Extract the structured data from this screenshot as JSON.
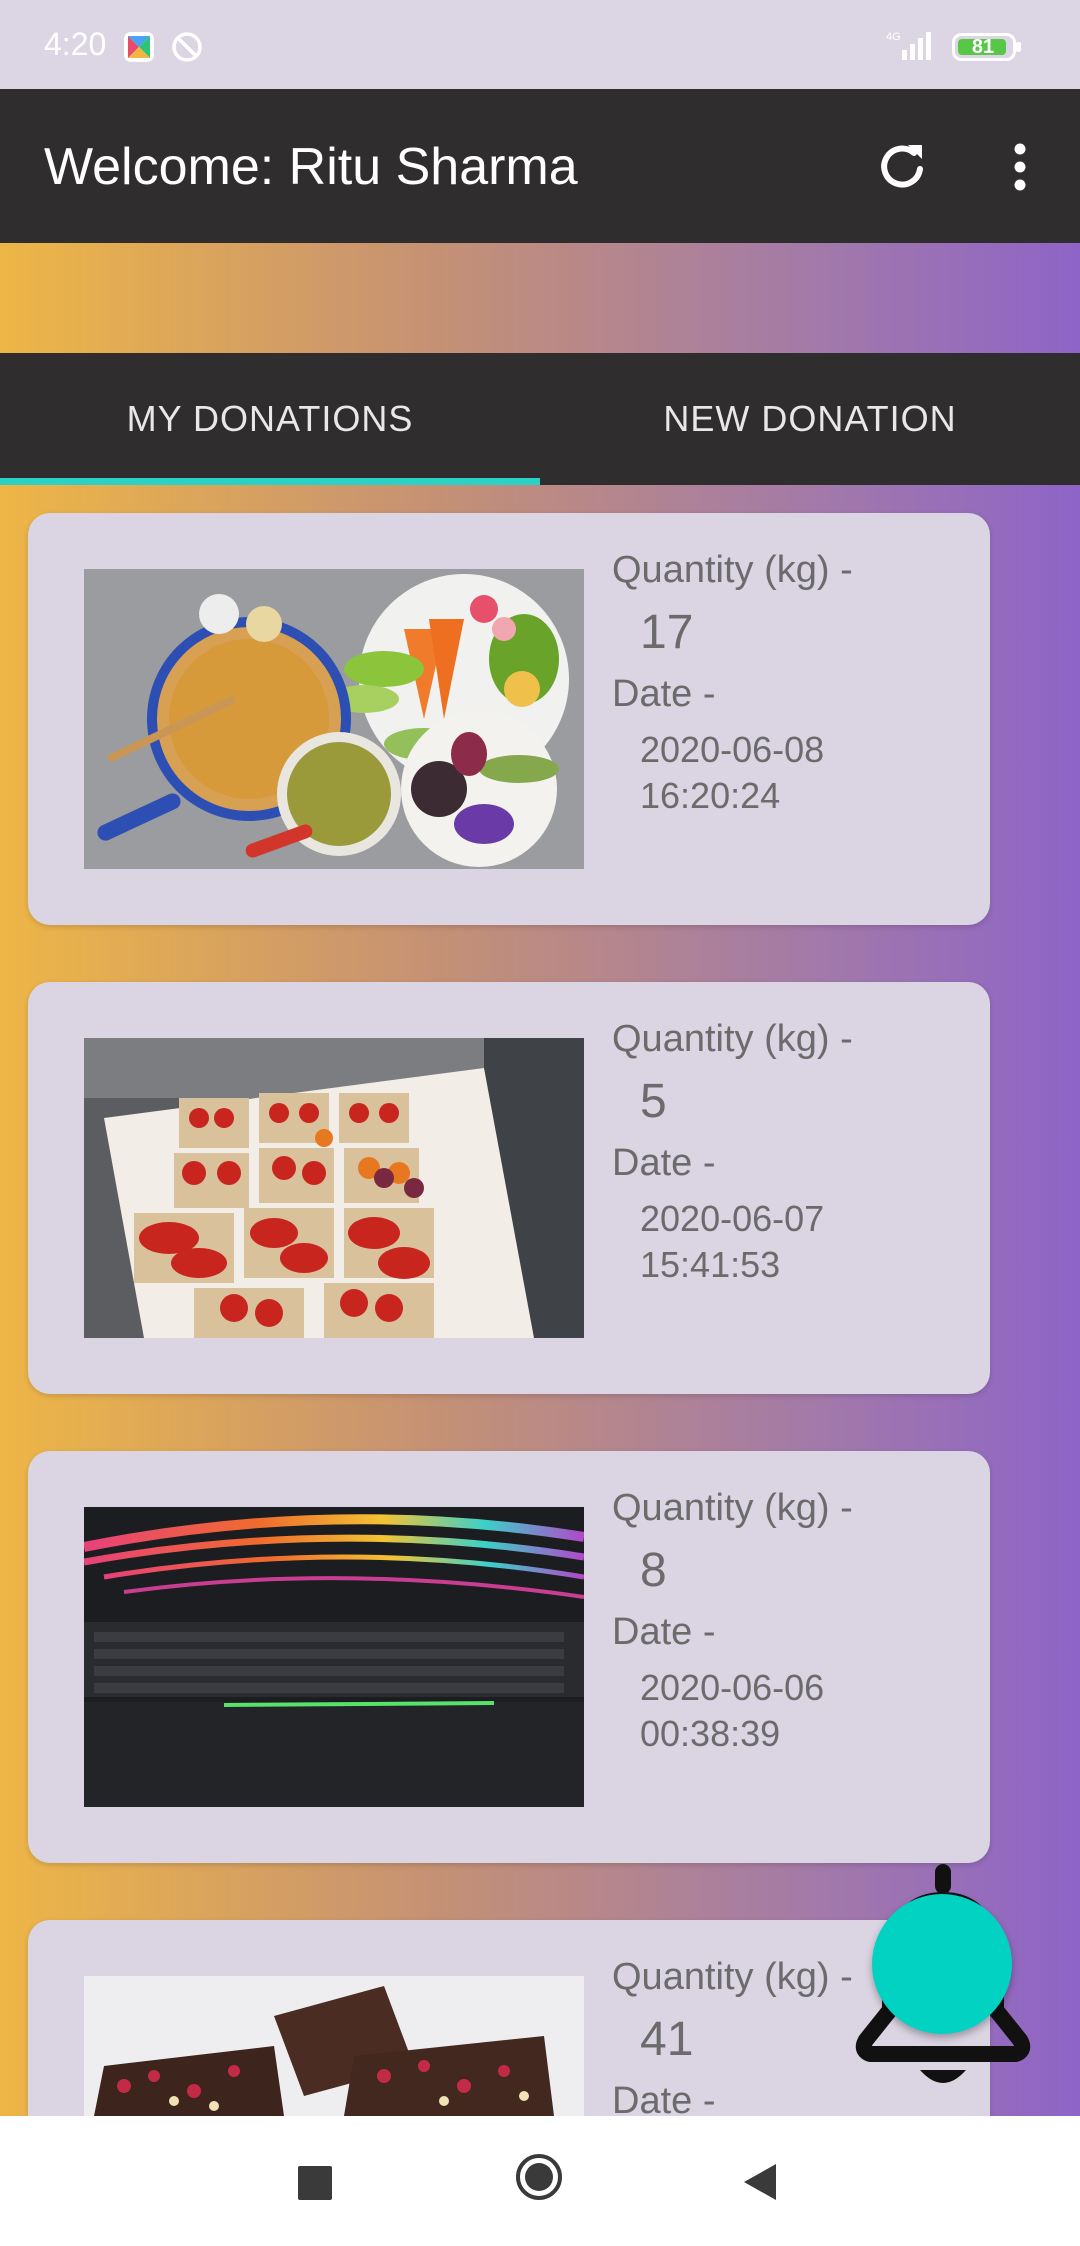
{
  "status_bar": {
    "time": "4:20",
    "network": "4G",
    "battery": "81"
  },
  "app_bar": {
    "title": "Welcome: Ritu Sharma"
  },
  "tabs": [
    {
      "label": "MY DONATIONS",
      "selected": true
    },
    {
      "label": "NEW DONATION",
      "selected": false
    }
  ],
  "donations": [
    {
      "quantity_label": "Quantity (kg) -",
      "quantity": "17",
      "date_label": "Date -",
      "date": "2020-06-08",
      "time": "16:20:24",
      "photo": "vegetables-and-chickpeas"
    },
    {
      "quantity_label": "Quantity (kg) -",
      "quantity": "5",
      "date_label": "Date -",
      "date": "2020-06-07",
      "time": "15:41:53",
      "photo": "tomatoes-in-boxes"
    },
    {
      "quantity_label": "Quantity (kg) -",
      "quantity": "8",
      "date_label": "Date -",
      "date": "2020-06-06",
      "time": "00:38:39",
      "photo": "laptop-keyboard"
    },
    {
      "quantity_label": "Quantity (kg) -",
      "quantity": "41",
      "date_label": "Date -",
      "date": "",
      "time": "",
      "photo": "chocolate-bark"
    }
  ],
  "colors": {
    "appbar": "#2f2d2e",
    "tab_indicator": "#2ad1c4",
    "fab": "#01d2c2",
    "card": "#dbd4e3"
  }
}
